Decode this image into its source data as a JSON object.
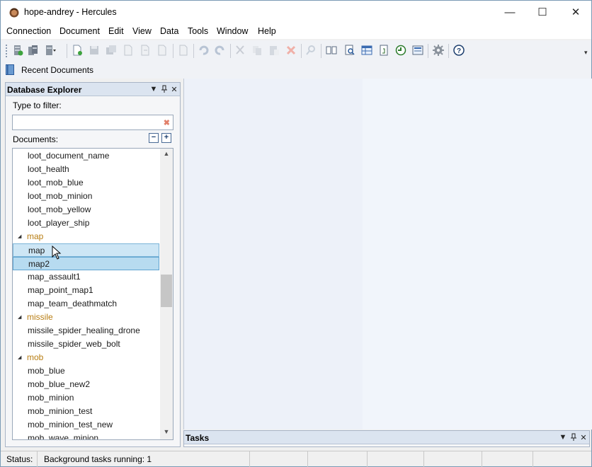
{
  "window": {
    "title": "hope-andrey - Hercules",
    "minimize": "—",
    "maximize": "☐",
    "close": "✕"
  },
  "menu": [
    "Connection",
    "Document",
    "Edit",
    "View",
    "Data",
    "Tools",
    "Window",
    "Help"
  ],
  "toolbar": {
    "icons": [
      "new-database-icon",
      "copy-database-icon",
      "database-menu-icon",
      "new-document-icon",
      "save-icon",
      "save-all-icon",
      "export-icon",
      "import-icon",
      "revert-icon",
      "properties-icon",
      "undo-icon",
      "redo-icon",
      "cut-icon",
      "copy-icon",
      "paste-icon",
      "delete-icon",
      "find-icon",
      "compare-icon",
      "search-icon",
      "grid-icon",
      "schema-icon",
      "history-icon",
      "preview-icon",
      "settings-icon",
      "help-icon"
    ]
  },
  "recent": {
    "label": "Recent Documents"
  },
  "explorer": {
    "title": "Database Explorer",
    "filter_label": "Type to filter:",
    "filter_value": "",
    "documents_label": "Documents:",
    "collapse": "−",
    "expand": "+",
    "rows": [
      {
        "type": "item",
        "label": "loot_document_name"
      },
      {
        "type": "item",
        "label": "loot_health"
      },
      {
        "type": "item",
        "label": "loot_mob_blue"
      },
      {
        "type": "item",
        "label": "loot_mob_minion"
      },
      {
        "type": "item",
        "label": "loot_mob_yellow"
      },
      {
        "type": "item",
        "label": "loot_player_ship"
      },
      {
        "type": "group",
        "label": "map"
      },
      {
        "type": "item",
        "label": "map",
        "state": "hover"
      },
      {
        "type": "item",
        "label": "map2",
        "state": "selected"
      },
      {
        "type": "item",
        "label": "map_assault1"
      },
      {
        "type": "item",
        "label": "map_point_map1"
      },
      {
        "type": "item",
        "label": "map_team_deathmatch"
      },
      {
        "type": "group",
        "label": "missile"
      },
      {
        "type": "item",
        "label": "missile_spider_healing_drone"
      },
      {
        "type": "item",
        "label": "missile_spider_web_bolt"
      },
      {
        "type": "group",
        "label": "mob"
      },
      {
        "type": "item",
        "label": "mob_blue"
      },
      {
        "type": "item",
        "label": "mob_blue_new2"
      },
      {
        "type": "item",
        "label": "mob_minion"
      },
      {
        "type": "item",
        "label": "mob_minion_test"
      },
      {
        "type": "item",
        "label": "mob_minion_test_new"
      },
      {
        "type": "item",
        "label": "mob_wave_minion"
      }
    ]
  },
  "tasks": {
    "title": "Tasks"
  },
  "status": {
    "label": "Status:",
    "text": "Background tasks running: 1"
  },
  "colors": {
    "group_text": "#b87d12",
    "selection": "#b7dbf0",
    "panel_header": "#dbe4f0"
  }
}
